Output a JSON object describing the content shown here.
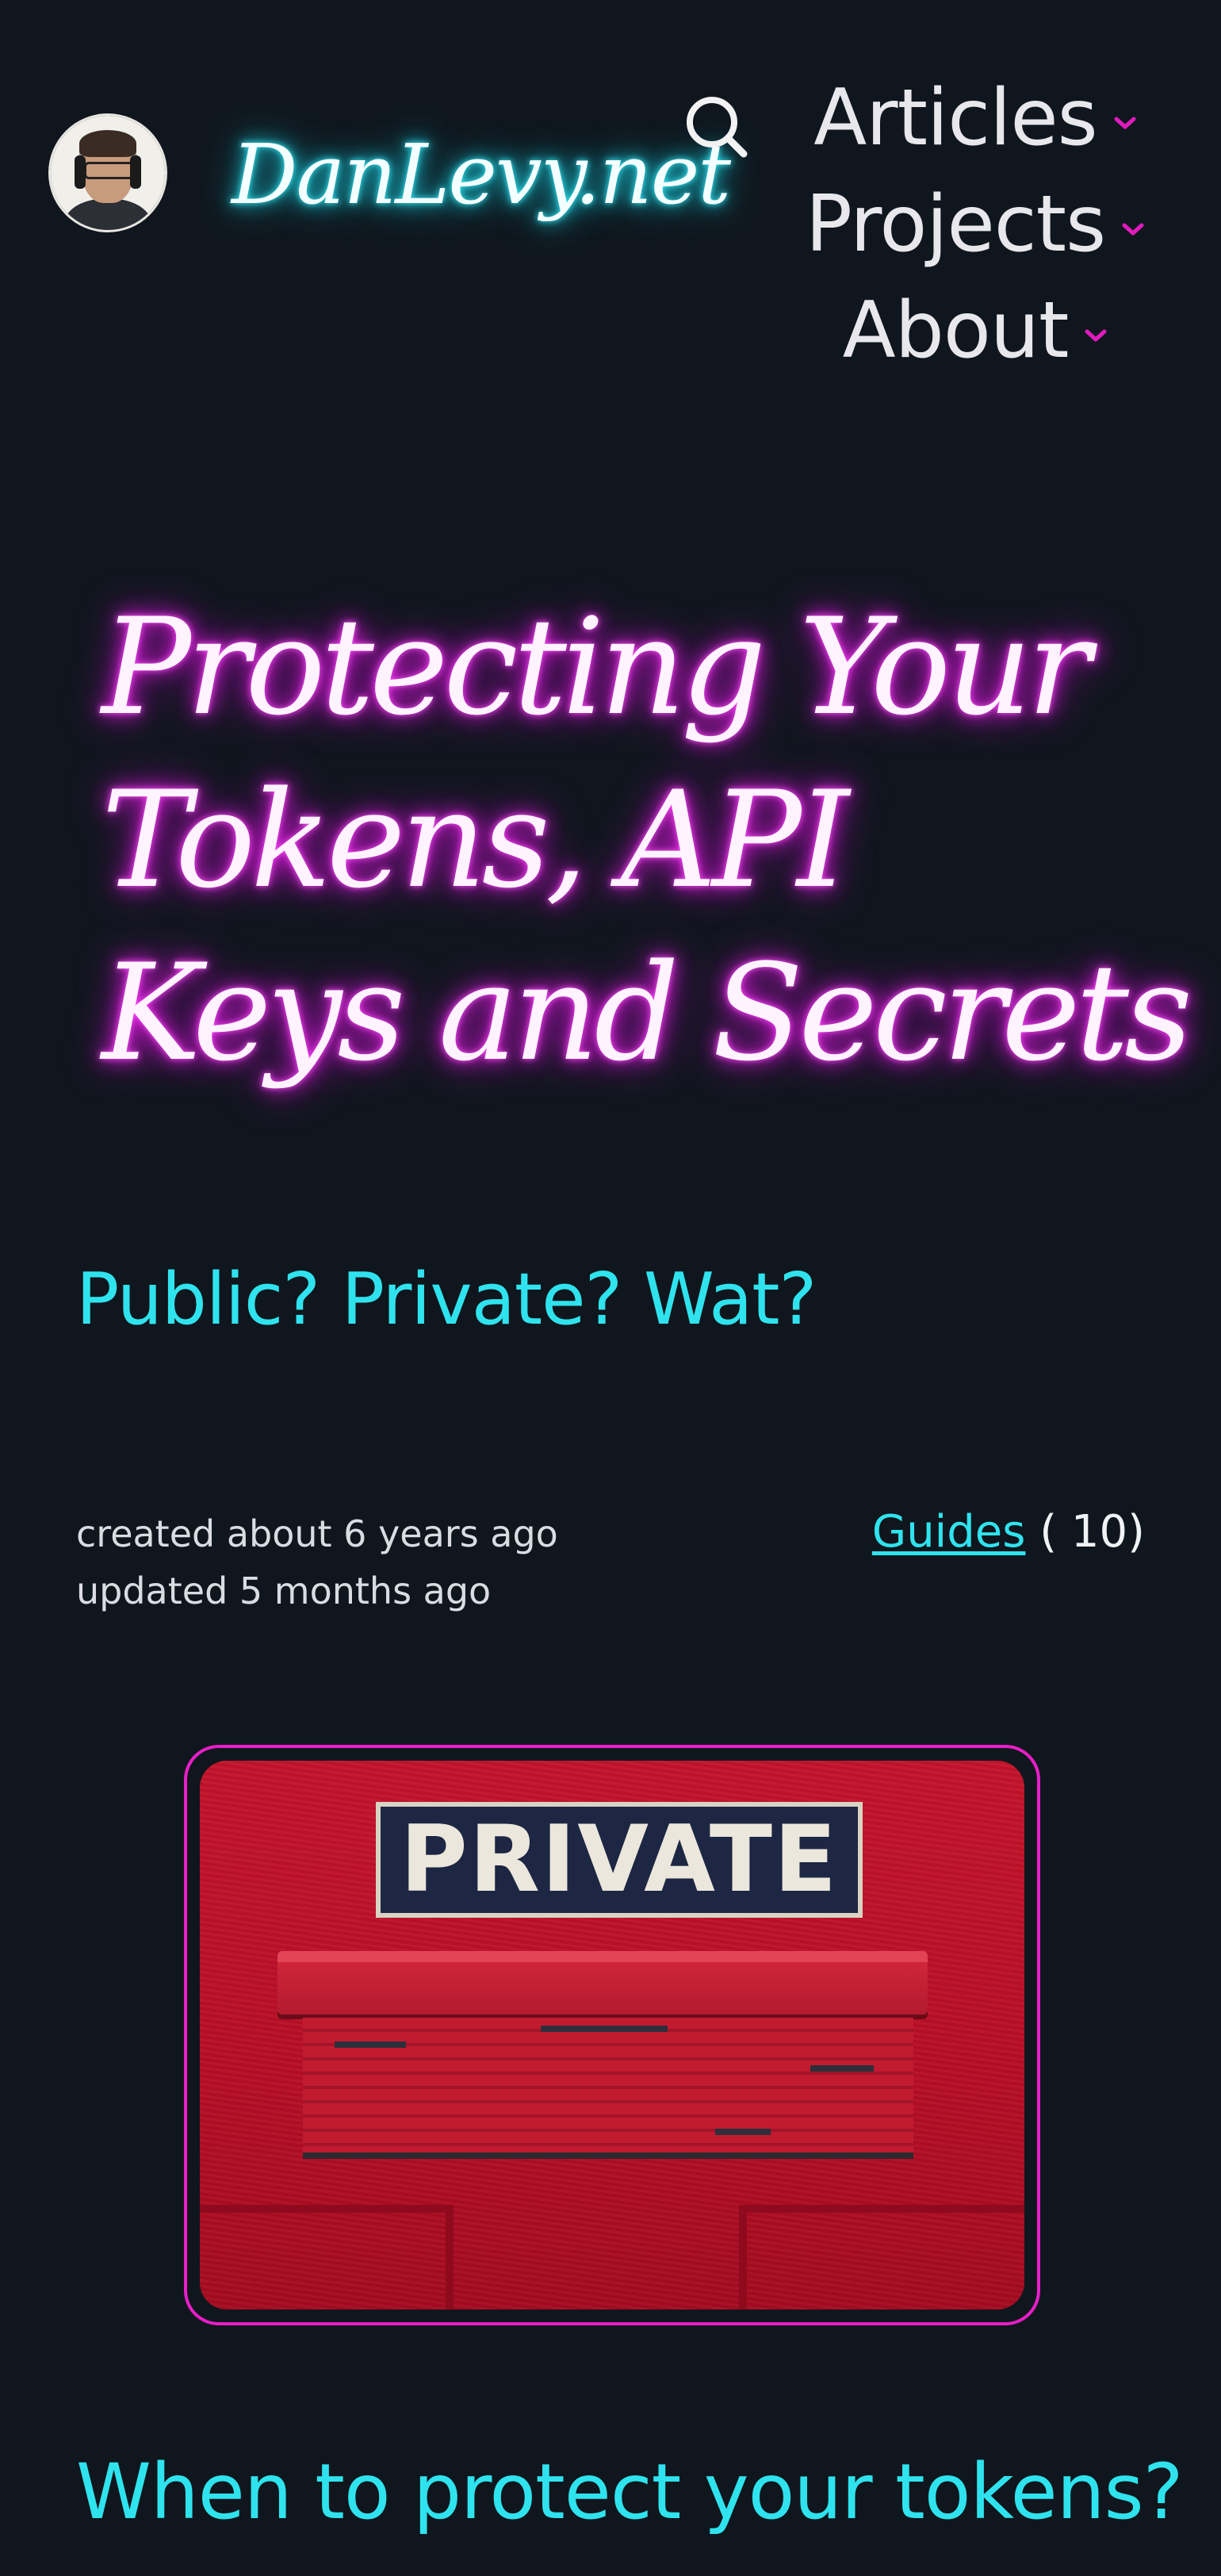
{
  "site": {
    "brand": "DanLevy.net"
  },
  "nav": {
    "items": [
      {
        "label": "Articles"
      },
      {
        "label": "Projects"
      },
      {
        "label": "About"
      }
    ],
    "accent_color": "#e21bbf"
  },
  "article": {
    "title_lines": [
      "Protecting Your",
      "Tokens, API",
      "Keys and Secrets"
    ],
    "subtitle": "Public? Private? Wat?",
    "created": "created about 6 years ago",
    "updated": "updated 5 months ago",
    "category": {
      "label": "Guides",
      "count": "( 10)"
    },
    "image": {
      "sign_text": "PRIVATE"
    },
    "section_heading": "When to protect your tokens?"
  },
  "colors": {
    "background": "#10161d",
    "cyan": "#2fe3ee",
    "magenta": "#ea1ec8"
  }
}
